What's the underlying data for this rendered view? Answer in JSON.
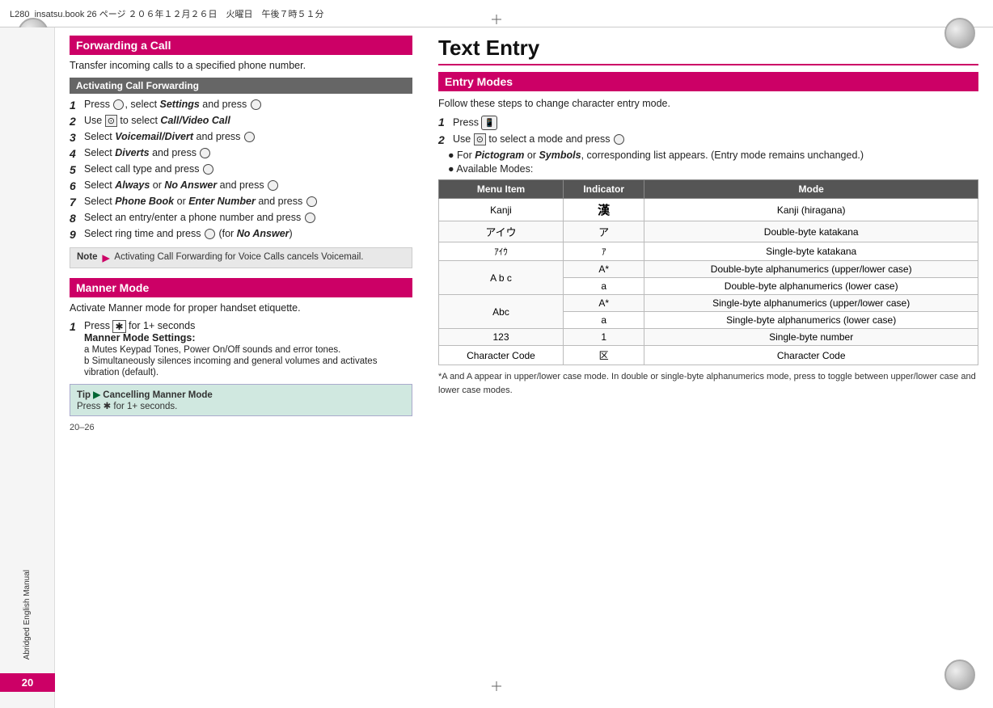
{
  "page": {
    "top_bar_text": "L280_insatsu.book  26 ページ  ２０６年１２月２６日　火曜日　午後７時５１分",
    "page_number": "20",
    "bottom_page_ref": "20–26",
    "sidebar_label": "Abridged English Manual"
  },
  "left": {
    "forwarding_header": "Forwarding a Call",
    "forwarding_intro": "Transfer incoming calls to a specified phone number.",
    "activating_header": "Activating Call Forwarding",
    "steps": [
      {
        "num": "1",
        "text": "Press ●, select Settings and press ●"
      },
      {
        "num": "2",
        "text": "Use ⊙ to select Call/Video Call"
      },
      {
        "num": "3",
        "text": "Select Voicemail/Divert and press ●"
      },
      {
        "num": "4",
        "text": "Select Diverts and press ●"
      },
      {
        "num": "5",
        "text": "Select call type and press ●"
      },
      {
        "num": "6",
        "text": "Select Always or No Answer and press ●"
      },
      {
        "num": "7",
        "text": "Select Phone Book or Enter Number and press ●"
      },
      {
        "num": "8",
        "text": "Select an entry/enter a phone number and press ●"
      },
      {
        "num": "9",
        "text": "Select ring time and press ● (for No Answer)"
      }
    ],
    "note_label": "Note",
    "note_text": "Activating Call Forwarding for Voice Calls cancels Voicemail.",
    "manner_header": "Manner Mode",
    "manner_intro": "Activate Manner mode for proper handset etiquette.",
    "manner_steps": [
      {
        "num": "1",
        "text": "Press ✱ for 1+ seconds",
        "sub_title": "Manner Mode Settings:",
        "sub_items": [
          "a Mutes Keypad Tones, Power On/Off sounds and error tones.",
          "b Simultaneously silences incoming and general volumes and activates vibration (default)."
        ]
      }
    ],
    "tip_label": "Tip",
    "tip_title": "Cancelling Manner Mode",
    "tip_text": "Press ✱ for 1+ seconds."
  },
  "right": {
    "main_title": "Text Entry",
    "entry_modes_header": "Entry Modes",
    "entry_intro": "Follow these steps to change character entry mode.",
    "steps": [
      {
        "num": "1",
        "text": "Press"
      },
      {
        "num": "2",
        "text": "Use ⊙ to select a mode and press ●"
      }
    ],
    "bullet1": "For Pictogram or Symbols, corresponding list appears. (Entry mode remains unchanged.)",
    "bullet2": "Available Modes:",
    "table": {
      "headers": [
        "Menu Item",
        "Indicator",
        "Mode"
      ],
      "rows": [
        {
          "menu": "Kanji",
          "indicator": "漢",
          "mode": "Kanji (hiragana)"
        },
        {
          "menu": "アイウ",
          "indicator": "ア",
          "mode": "Double-byte katakana"
        },
        {
          "menu": "ｱｲｳ",
          "indicator": "ｱ",
          "mode": "Single-byte katakana"
        },
        {
          "menu": "A b c",
          "indicator": "A*",
          "mode": "Double-byte alphanumerics (upper/lower case)"
        },
        {
          "menu": "",
          "indicator": "a",
          "mode": "Double-byte alphanumerics (lower case)"
        },
        {
          "menu": "Abc",
          "indicator": "A*",
          "mode": "Single-byte alphanumerics (upper/lower case)"
        },
        {
          "menu": "",
          "indicator": "a",
          "mode": "Single-byte alphanumerics (lower case)"
        },
        {
          "menu": "123",
          "indicator": "1",
          "mode": "Single-byte number"
        },
        {
          "menu": "Character Code",
          "indicator": "区",
          "mode": "Character Code"
        }
      ]
    },
    "footnote": "*A  and  A  appear in upper/lower case mode. In double or single-byte alphanumerics mode, press       to toggle between upper/lower case and lower case modes."
  }
}
